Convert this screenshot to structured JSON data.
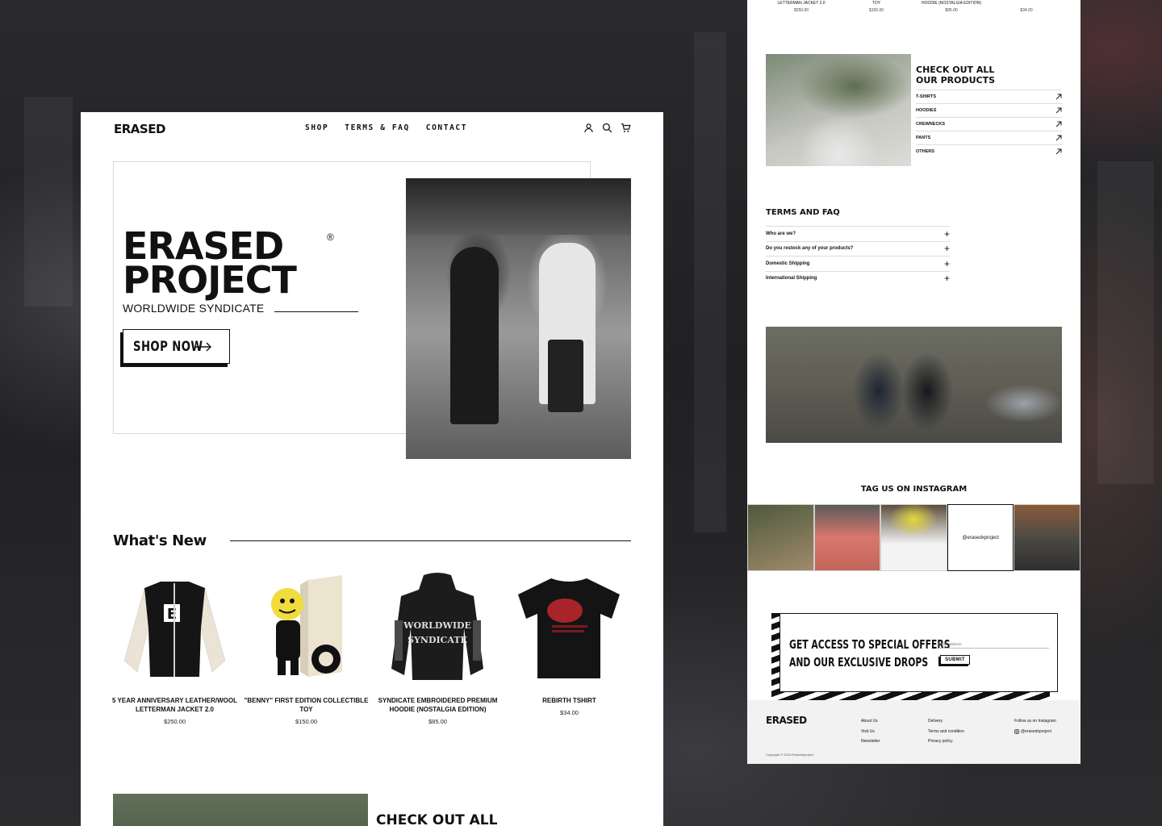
{
  "brand": "ERASED",
  "nav": {
    "links": [
      "SHOP",
      "TERMS & FAQ",
      "CONTACT"
    ]
  },
  "hero": {
    "title_line1": "ERASED",
    "title_line2": "PROJECT",
    "reg_mark": "®",
    "subtitle": "WORLDWIDE SYNDICATE",
    "cta": "SHOP NOW"
  },
  "whats_new": {
    "title": "What's New",
    "products": [
      {
        "name": "5 YEAR ANNIVERSARY LEATHER/WOOL LETTERMAN JACKET 2.0",
        "price": "$250.00"
      },
      {
        "name": "\"BENNY\" FIRST EDITION COLLECTIBLE TOY",
        "price": "$150.00"
      },
      {
        "name": "SYNDICATE EMBROIDERED PREMIUM HOODIE (NOSTALGIA EDITION)",
        "price": "$85.00"
      },
      {
        "name": "REBIRTH TSHIRT",
        "price": "$34.00"
      }
    ]
  },
  "check_out": {
    "title_line1": "CHECK OUT ALL",
    "title_line2": "OUR PRODUCTS",
    "categories": [
      "T-SHIRTS",
      "HOODIES",
      "CREWNECKS",
      "PANTS",
      "OTHERS"
    ]
  },
  "top_strip": {
    "names": [
      "LETTERMAN JACKET 2.0",
      "TOY",
      "HOODIE (NOSTALGIA EDITION)",
      ""
    ],
    "prices": [
      "$250.00",
      "$150.00",
      "$85.00",
      "$34.00"
    ]
  },
  "faq": {
    "title": "TERMS AND FAQ",
    "items": [
      "Who are we?",
      "Do you restock any of your products?",
      "Domestic Shipping",
      "International Shipping"
    ]
  },
  "instagram": {
    "title": "TAG US ON INSTAGRAM",
    "handle": "@erasedxproject"
  },
  "newsletter": {
    "line1": "GET ACCESS TO SPECIAL OFFERS",
    "line2": "AND OUR EXCLUSIVE DROPS",
    "placeholder": "Email address",
    "submit": "SUBMIT"
  },
  "footer": {
    "col1": [
      "About Us",
      "Visit Us",
      "Newsletter"
    ],
    "col2": [
      "Delivery",
      "Terms and condition",
      "Privacy policy"
    ],
    "follow": "Follow us on Instagram",
    "handle": "@erasedxproject",
    "copyright": "Copyright © 2023 Erasedxproject"
  }
}
